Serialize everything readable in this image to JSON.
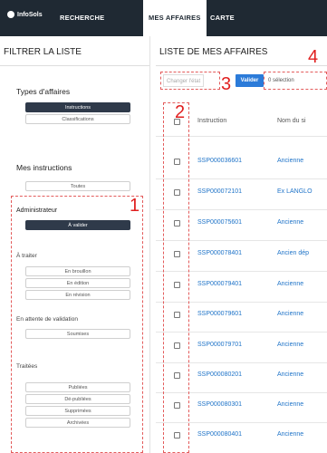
{
  "header": {
    "logo": "InfoSols",
    "nav": [
      {
        "label": "RECHERCHE"
      },
      {
        "label": "MES AFFAIRES"
      },
      {
        "label": "CARTE"
      }
    ]
  },
  "left": {
    "title": "FILTRER LA LISTE",
    "types_title": "Types d'affaires",
    "types": [
      "Instructions",
      "Classifications"
    ],
    "mes_title": "Mes instructions",
    "mes_items": [
      "Toutes"
    ],
    "admin_title": "Administrateur",
    "admin_items": [
      "À valider"
    ],
    "traiter_title": "À traiter",
    "traiter_items": [
      "En brouillon",
      "En édition",
      "En révision"
    ],
    "attente_title": "En attente de validation",
    "attente_items": [
      "Soumises"
    ],
    "traitees_title": "Traitées",
    "traitees_items": [
      "Publiées",
      "Dé-publiées",
      "Supprimées",
      "Archivées"
    ]
  },
  "right": {
    "title": "LISTE DE MES AFFAIRES",
    "changer_label": "Changer l'état",
    "valider_label": "Valider",
    "selection_label": "0 sélection",
    "columns": [
      "Instruction",
      "Nom du si"
    ],
    "rows": [
      {
        "id": "SSP000036601",
        "name": "Ancienne"
      },
      {
        "id": "SSP000072101",
        "name": "Ex LANGLO"
      },
      {
        "id": "SSP000075601",
        "name": "Ancienne"
      },
      {
        "id": "SSP000078401",
        "name": "Ancien dép"
      },
      {
        "id": "SSP000079401",
        "name": "Ancienne"
      },
      {
        "id": "SSP000079601",
        "name": "Ancienne"
      },
      {
        "id": "SSP000079701",
        "name": "Ancienne"
      },
      {
        "id": "SSP000080201",
        "name": "Ancienne"
      },
      {
        "id": "SSP000080301",
        "name": "Ancienne"
      },
      {
        "id": "SSP000080401",
        "name": "Ancienne"
      }
    ]
  },
  "annotations": [
    "1",
    "2",
    "3",
    "4"
  ],
  "colors": {
    "accent": "#2b7bd9",
    "nav_bg": "#1f2933",
    "annotation": "#e01f1f",
    "link": "#1e73c8"
  }
}
